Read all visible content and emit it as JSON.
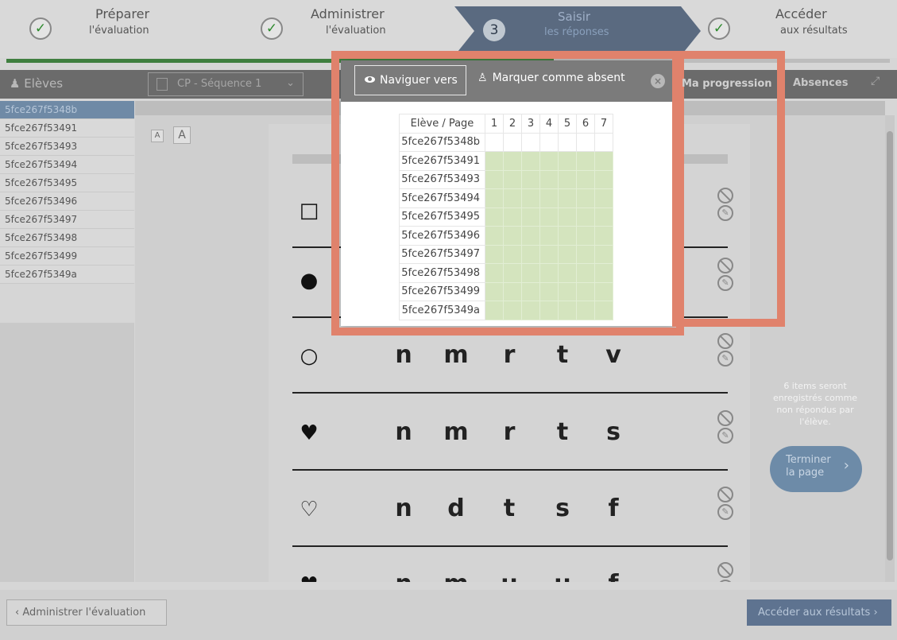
{
  "steps": [
    {
      "title": "Préparer",
      "subtitle": "l'évaluation"
    },
    {
      "title": "Administrer",
      "subtitle": "l'évaluation"
    },
    {
      "number": "3",
      "title": "Saisir",
      "subtitle": "les réponses"
    },
    {
      "title": "Accéder",
      "subtitle": "aux résultats"
    }
  ],
  "progress": 0.62,
  "sidebar": {
    "title": "Elèves",
    "students": [
      "5fce267f5348b",
      "5fce267f53491",
      "5fce267f53493",
      "5fce267f53494",
      "5fce267f53495",
      "5fce267f53496",
      "5fce267f53497",
      "5fce267f53498",
      "5fce267f53499",
      "5fce267f5349a"
    ]
  },
  "toolbar": {
    "sequence": "CP - Séquence 1",
    "progression": "Ma progression",
    "absences": "Absences"
  },
  "font_buttons": {
    "small": "A",
    "large": "A"
  },
  "popup": {
    "navigate": "Naviguer vers",
    "mark_absent": "Marquer comme absent",
    "header": "Elève / Page",
    "pages": [
      "1",
      "2",
      "3",
      "4",
      "5",
      "6",
      "7"
    ]
  },
  "exercise": {
    "rows": [
      {
        "symbol": "□",
        "letters": []
      },
      {
        "symbol": "●",
        "letters": []
      },
      {
        "symbol": "○",
        "letters": [
          "n",
          "m",
          "r",
          "t",
          "v"
        ]
      },
      {
        "symbol": "♥",
        "letters": [
          "n",
          "m",
          "r",
          "t",
          "s"
        ]
      },
      {
        "symbol": "♡",
        "letters": [
          "n",
          "d",
          "t",
          "s",
          "f"
        ]
      },
      {
        "symbol": "♥",
        "letters": [
          "n",
          "m",
          "u",
          "u",
          "f"
        ]
      }
    ]
  },
  "side_note": "6 items seront enregistrés comme non répondus par l'élève.",
  "finish_button": {
    "line1": "Terminer",
    "line2": "la page"
  },
  "footer": {
    "prev": "Administrer l'évaluation",
    "next": "Accéder aux résultats"
  },
  "colors": {
    "highlight": "#e0826c",
    "done": "#d4e4be",
    "active_step": "#5a6a80"
  }
}
